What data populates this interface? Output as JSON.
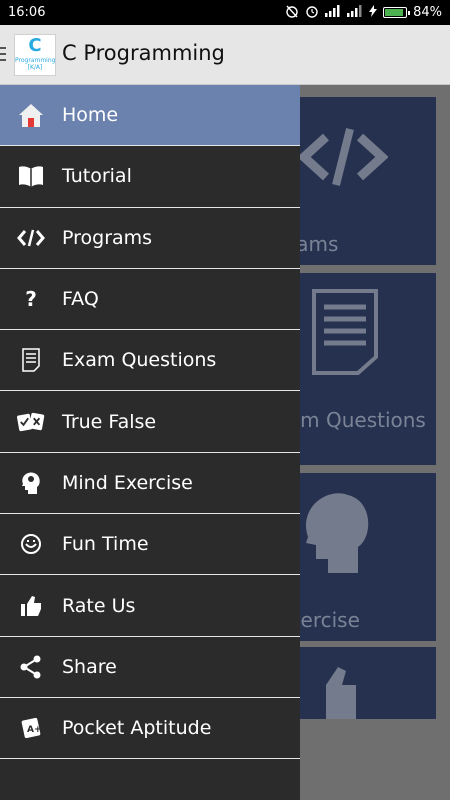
{
  "status_bar": {
    "time": "16:06",
    "battery_text": "84%",
    "battery_level": 0.84
  },
  "app_bar": {
    "title": "C Programming",
    "logo_letter": "C",
    "logo_caption_1": "Programming",
    "logo_caption_2": "[K/A]"
  },
  "drawer": {
    "items": [
      {
        "label": "Home",
        "icon": "home-icon",
        "active": true
      },
      {
        "label": "Tutorial",
        "icon": "book-icon"
      },
      {
        "label": "Programs",
        "icon": "code-icon"
      },
      {
        "label": "FAQ",
        "icon": "question-icon"
      },
      {
        "label": "Exam Questions",
        "icon": "document-icon"
      },
      {
        "label": "True False",
        "icon": "true-false-icon"
      },
      {
        "label": "Mind Exercise",
        "icon": "brain-icon"
      },
      {
        "label": "Fun Time",
        "icon": "smiley-icon"
      },
      {
        "label": "Rate Us",
        "icon": "thumbs-up-icon"
      },
      {
        "label": "Share",
        "icon": "share-icon"
      },
      {
        "label": "Pocket Aptitude",
        "icon": "aptitude-icon"
      }
    ]
  },
  "background_tiles": [
    {
      "label": "Programs"
    },
    {
      "label": "University Exam Questions"
    },
    {
      "label": "Mind Exercise"
    }
  ],
  "colors": {
    "drawer_bg": "#2b2b2b",
    "active_item": "#6a82ad",
    "tile_bg": "#25314f"
  }
}
